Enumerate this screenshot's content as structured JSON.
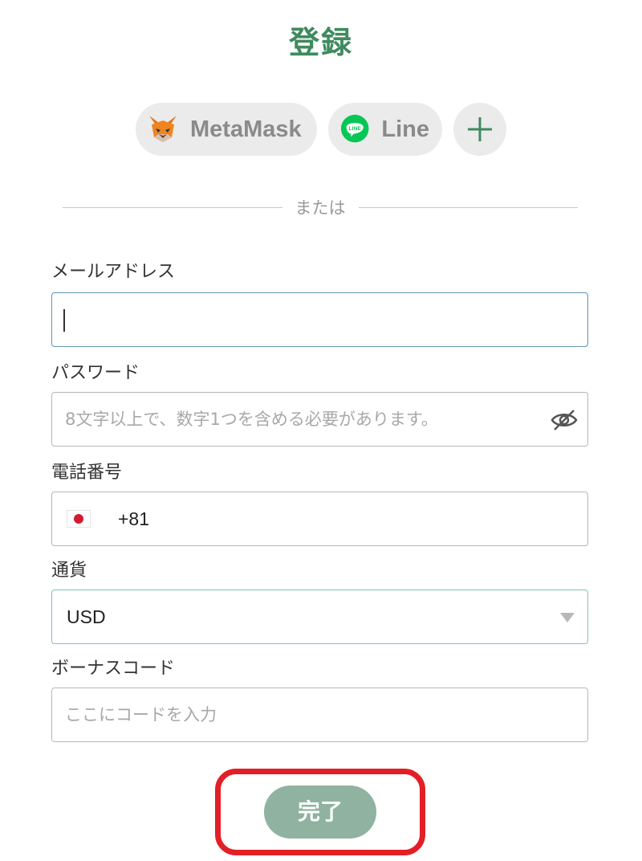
{
  "title": "登録",
  "social": {
    "metamask_label": "MetaMask",
    "line_label": "Line",
    "line_badge": "LINE"
  },
  "divider_text": "または",
  "email": {
    "label": "メールアドレス",
    "value": "",
    "placeholder": ""
  },
  "password": {
    "label": "パスワード",
    "value": "",
    "placeholder": "8文字以上で、数字1つを含める必要があります。"
  },
  "phone": {
    "label": "電話番号",
    "country": "Japan",
    "dial_code": "+81"
  },
  "currency": {
    "label": "通貨",
    "selected": "USD"
  },
  "bonus": {
    "label": "ボーナスコード",
    "value": "",
    "placeholder": "ここにコードを入力"
  },
  "submit_label": "完了",
  "colors": {
    "title_green": "#3f8a5f",
    "button_green": "#8fb3a0",
    "highlight_red": "#e31f26",
    "line_green": "#06c755",
    "focus_border": "#5e97a8",
    "select_border": "#7cc9a5"
  }
}
